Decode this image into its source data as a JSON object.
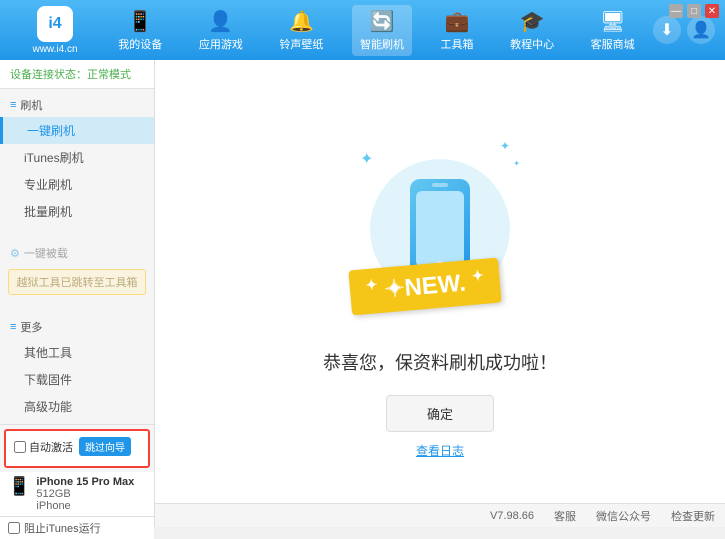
{
  "app": {
    "logo_char": "i4",
    "logo_url": "www.i4.cn"
  },
  "window_controls": {
    "minimize": "—",
    "maximize": "□",
    "close": "✕"
  },
  "nav": {
    "items": [
      {
        "id": "my-device",
        "icon": "📱",
        "label": "我的设备"
      },
      {
        "id": "apps-games",
        "icon": "👤",
        "label": "应用游戏"
      },
      {
        "id": "ringtone",
        "icon": "🔔",
        "label": "铃声壁纸"
      },
      {
        "id": "smart-flash",
        "icon": "🔄",
        "label": "智能刷机",
        "active": true
      },
      {
        "id": "toolbox",
        "icon": "💼",
        "label": "工具箱"
      },
      {
        "id": "tutorial",
        "icon": "🎓",
        "label": "教程中心"
      },
      {
        "id": "service",
        "icon": "🖥",
        "label": "客服商城"
      }
    ]
  },
  "sidebar": {
    "status_label": "设备连接状态：",
    "status_value": "正常模式",
    "flash_section": "刷机",
    "items": [
      {
        "id": "one-key-flash",
        "label": "一键刷机",
        "active": true
      },
      {
        "id": "itunes-flash",
        "label": "iTunes刷机"
      },
      {
        "id": "pro-flash",
        "label": "专业刷机"
      },
      {
        "id": "batch-flash",
        "label": "批量刷机"
      }
    ],
    "restore_section": "一键被载",
    "restore_disabled_label": "越狱工具已跳转至工具箱",
    "more_section": "更多",
    "more_items": [
      {
        "id": "other-tools",
        "label": "其他工具"
      },
      {
        "id": "download-firmware",
        "label": "下载固件"
      },
      {
        "id": "advanced",
        "label": "高级功能"
      }
    ],
    "auto_activate_label": "自动激活",
    "guide_label": "跳过向导",
    "device": {
      "name": "iPhone 15 Pro Max",
      "storage": "512GB",
      "type": "iPhone"
    },
    "itunes_label": "阻止iTunes运行"
  },
  "content": {
    "success_title": "恭喜您，保资料刷机成功啦！",
    "confirm_btn": "确定",
    "log_link": "查看日志",
    "new_badge": "NEW."
  },
  "footer": {
    "version": "V7.98.66",
    "items": [
      {
        "id": "homepage",
        "label": "客服"
      },
      {
        "id": "wechat",
        "label": "微信公众号"
      },
      {
        "id": "check-update",
        "label": "检查更新"
      }
    ]
  }
}
